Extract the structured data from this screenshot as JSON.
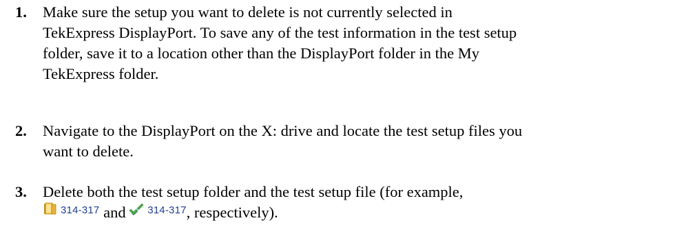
{
  "steps": [
    {
      "number": "1.",
      "lines": [
        "Make sure the setup you want to delete is not currently selected in",
        "TekExpress DisplayPort. To save any of the test information in the test setup",
        "folder, save it to a location other than the DisplayPort folder in the My",
        "TekExpress folder."
      ]
    },
    {
      "number": "2.",
      "lines": [
        "Navigate to the DisplayPort on the X: drive and locate the test setup files you",
        "want to delete."
      ]
    },
    {
      "number": "3.",
      "line1": "Delete both the test setup folder and the test setup file (for example,",
      "folder_label": "314-317",
      "and_text": "and",
      "file_label": "314-317",
      "tail_text": ", respectively)."
    }
  ],
  "icons": {
    "folder": "folder-icon",
    "setup_file": "test-setup-file-icon"
  },
  "colors": {
    "folder_icon": "#e8b23a",
    "setup_file_check": "#4caf3a",
    "file_label": "#1f3f8f"
  }
}
